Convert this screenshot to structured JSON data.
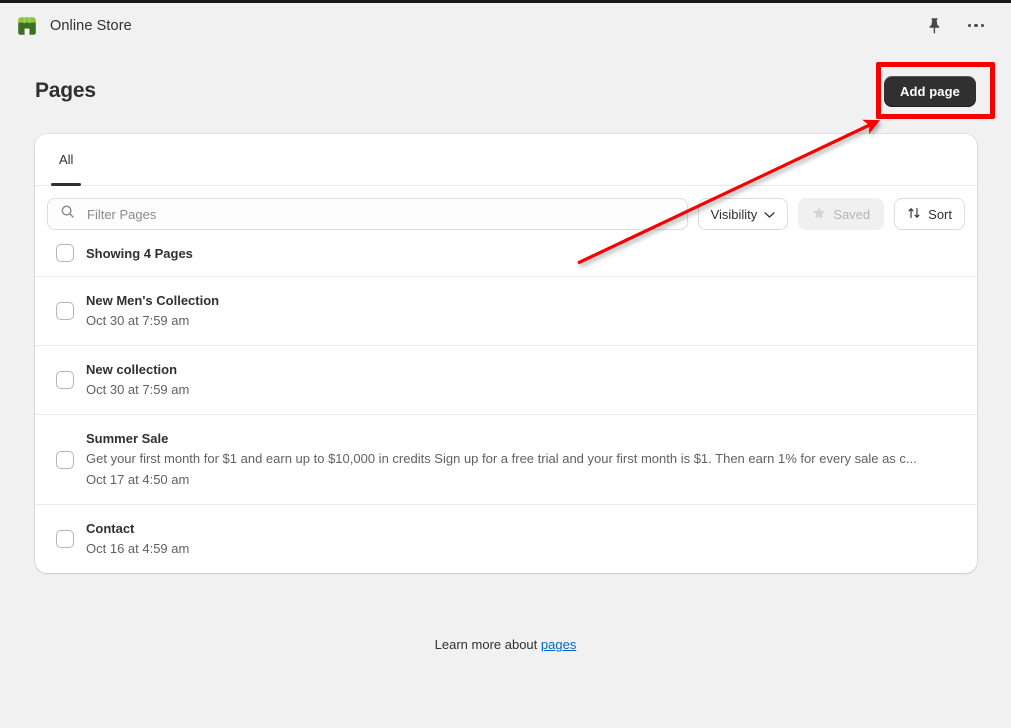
{
  "topbar": {
    "store_name": "Online Store",
    "logo_icon": "storefront-icon",
    "pin_icon": "pin-icon",
    "more_icon": "ellipsis-icon"
  },
  "header": {
    "title": "Pages",
    "add_button": "Add page"
  },
  "tabs": [
    {
      "label": "All",
      "active": true
    }
  ],
  "filters": {
    "search_placeholder": "Filter Pages",
    "search_value": "",
    "search_icon": "search-icon",
    "visibility_label": "Visibility",
    "visibility_icon": "chevron-down-icon",
    "saved_label": "Saved",
    "saved_icon": "star-icon",
    "saved_disabled": true,
    "sort_label": "Sort",
    "sort_icon": "sort-arrows-icon"
  },
  "list": {
    "showing_label": "Showing 4 Pages",
    "rows": [
      {
        "title": "New Men's Collection",
        "description": "",
        "date": "Oct 30 at 7:59 am"
      },
      {
        "title": "New collection",
        "description": "",
        "date": "Oct 30 at 7:59 am"
      },
      {
        "title": "Summer Sale",
        "description": "Get your first month for $1 and earn up to $10,000 in credits Sign up for a free trial and your first month is $1. Then earn 1% for every sale as c...",
        "date": "Oct 17 at 4:50 am"
      },
      {
        "title": "Contact",
        "description": "",
        "date": "Oct 16 at 4:59 am"
      }
    ]
  },
  "footer": {
    "text": "Learn more about",
    "link": "pages"
  },
  "annotations": {
    "highlight_color": "#f70000",
    "arrow_color": "#f70000",
    "target": "Add page"
  },
  "colors": {
    "page_background": "#f1f1f1",
    "card_background": "#ffffff",
    "primary_button": "#303030",
    "link": "#0066cc",
    "text_primary": "#303030",
    "text_secondary": "#616161"
  }
}
